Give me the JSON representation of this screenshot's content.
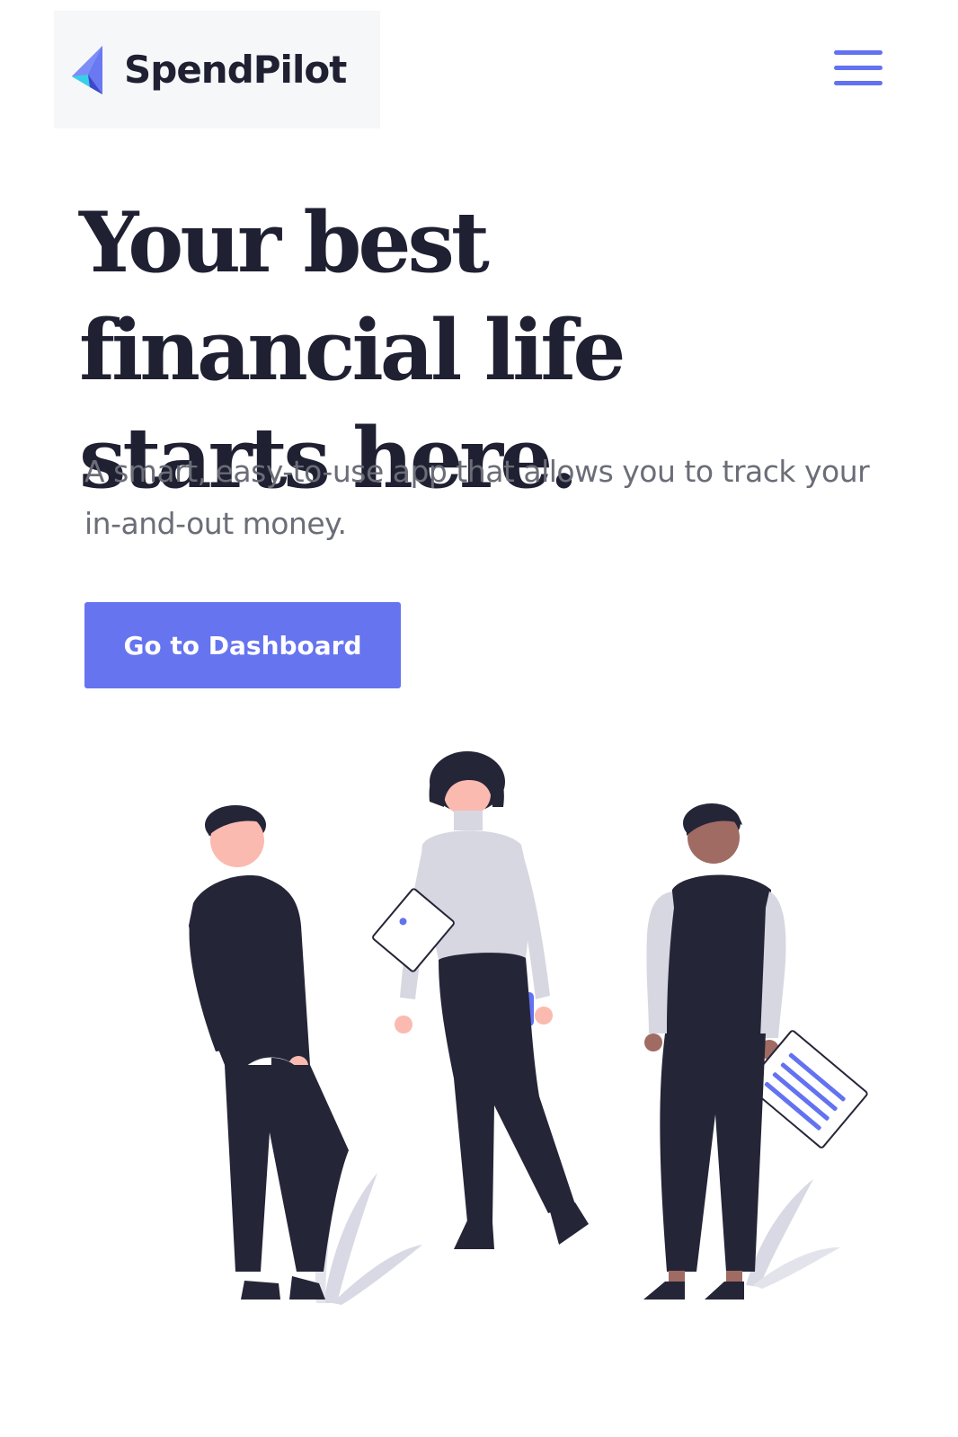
{
  "header": {
    "brand_name": "SpendPilot",
    "logo_icon": "paper-plane-logo-icon",
    "menu_icon": "hamburger-menu-icon"
  },
  "hero": {
    "title": "Your best financial life starts here.",
    "subtitle": "A smart, easy-to-use app that allows you to track your in-and-out money.",
    "cta_label": "Go to Dashboard"
  },
  "colors": {
    "accent": "#6674f0",
    "heading": "#1f2032",
    "body_text": "#6b6d77",
    "logo_box_bg": "#f6f7f8"
  }
}
